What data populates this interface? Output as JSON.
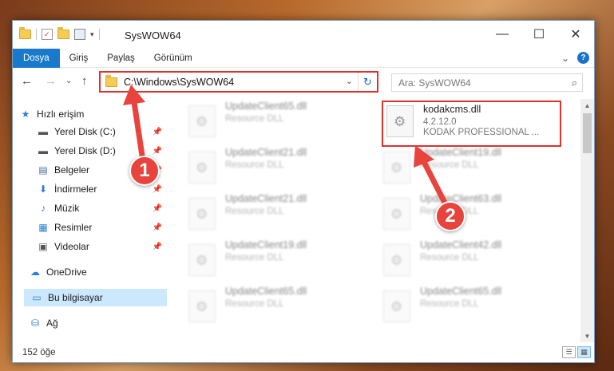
{
  "window": {
    "title": "SysWOW64"
  },
  "controls": {
    "minimize": "—",
    "maximize": "☐",
    "close": "✕"
  },
  "ribbon": {
    "tabs": [
      "Dosya",
      "Giriş",
      "Paylaş",
      "Görünüm"
    ],
    "collapse": "⌄",
    "help": "?"
  },
  "nav": {
    "back": "←",
    "forward": "→",
    "recent": "⌄",
    "up": "↑"
  },
  "address": {
    "path": "C:\\Windows\\SysWOW64",
    "dropdown": "⌄",
    "refresh": "↻"
  },
  "search": {
    "placeholder": "Ara: SysWOW64",
    "icon": "⌕"
  },
  "sidebar": [
    {
      "label": "Hızlı erişim",
      "icon": "★",
      "pinned": false
    },
    {
      "label": "Yerel Disk (C:)",
      "icon": "▬",
      "pinned": true
    },
    {
      "label": "Yerel Disk (D:)",
      "icon": "▬",
      "pinned": true
    },
    {
      "label": "Belgeler",
      "icon": "▤",
      "pinned": true
    },
    {
      "label": "İndirmeler",
      "icon": "⬇",
      "pinned": true
    },
    {
      "label": "Müzik",
      "icon": "♪",
      "pinned": true
    },
    {
      "label": "Resimler",
      "icon": "▦",
      "pinned": true
    },
    {
      "label": "Videolar",
      "icon": "▣",
      "pinned": true
    },
    {
      "label": "OneDrive",
      "icon": "☁",
      "pinned": false
    },
    {
      "label": "Bu bilgisayar",
      "icon": "▭",
      "pinned": false
    },
    {
      "label": "Ağ",
      "icon": "⛁",
      "pinned": false
    }
  ],
  "pin_glyph": "📌",
  "files_left": [
    {
      "name": "UpdateClient65.dll",
      "meta": "Resource DLL"
    },
    {
      "name": "UpdateClient21.dll",
      "meta": "Resource DLL"
    },
    {
      "name": "UpdateClient21.dll",
      "meta": "Resource DLL"
    },
    {
      "name": "UpdateClient19.dll",
      "meta": "Resource DLL"
    },
    {
      "name": "UpdateClient65.dll",
      "meta": "Resource DLL"
    }
  ],
  "files_right": [
    {
      "name": "kodakcms.dll",
      "version": "4.2.12.0",
      "meta": "KODAK PROFESSIONAL ..."
    },
    {
      "name": "UpdateClient19.dll",
      "meta": "Resource DLL"
    },
    {
      "name": "UpdateClient63.dll",
      "meta": "Resource DLL"
    },
    {
      "name": "UpdateClient42.dll",
      "meta": "Resource DLL"
    },
    {
      "name": "UpdateClient65.dll",
      "meta": "Resource DLL"
    }
  ],
  "status": {
    "count": "152 öğe"
  },
  "annotations": {
    "step1": "1",
    "step2": "2"
  },
  "colors": {
    "accent": "#1979ca",
    "annotation_red": "#e0312f"
  }
}
